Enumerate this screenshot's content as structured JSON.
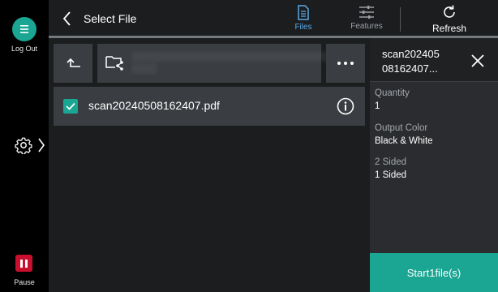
{
  "rail": {
    "logout_label": "Log Out",
    "pause_label": "Pause",
    "colors": {
      "logout": "#1aa693",
      "pause": "#c8102e"
    }
  },
  "header": {
    "title": "Select File",
    "tabs": [
      {
        "label": "Files",
        "icon": "document-icon",
        "active": true
      },
      {
        "label": "Features",
        "icon": "sliders-icon",
        "active": false
      }
    ],
    "refresh_label": "Refresh"
  },
  "toolbar": {
    "up_icon": "up-level-icon",
    "path_text": "░░░░░░░░░░░░░░░░░░░░░░░░░░░░░░░░░ ░░░░",
    "more_icon": "ellipsis-icon"
  },
  "files": [
    {
      "name": "scan20240508162407.pdf",
      "checked": true
    }
  ],
  "panel": {
    "title": "scan202405\n08162407...",
    "title_line1": "scan202405",
    "title_line2": "08162407...",
    "fields": [
      {
        "label": "Quantity",
        "value": "1"
      },
      {
        "label": "Output Color",
        "value": "Black & White"
      },
      {
        "label": "2 Sided",
        "value": "1 Sided"
      }
    ],
    "start_label": "Start1file(s)"
  },
  "colors": {
    "accent": "#1aa693",
    "active_tab": "#5aa9e6",
    "background": "#1c1d1f"
  }
}
